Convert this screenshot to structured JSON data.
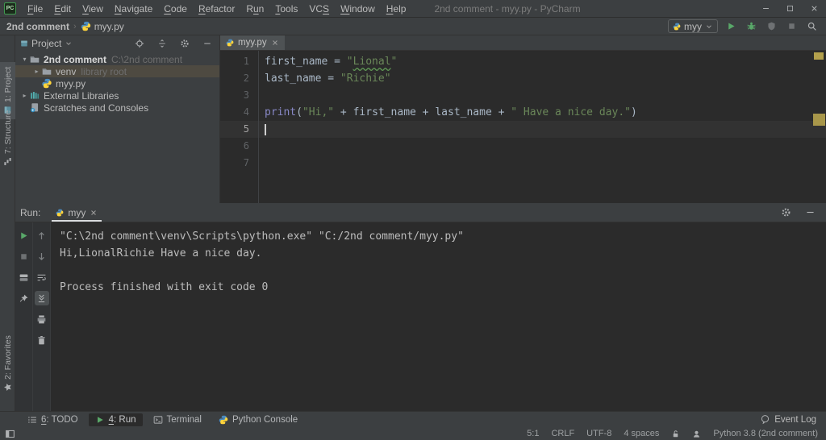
{
  "window": {
    "title": "2nd comment - myy.py - PyCharm",
    "logo_text": "PC"
  },
  "menu": {
    "items": [
      {
        "label": "File",
        "m": 0
      },
      {
        "label": "Edit",
        "m": 0
      },
      {
        "label": "View",
        "m": 0
      },
      {
        "label": "Navigate",
        "m": 0
      },
      {
        "label": "Code",
        "m": 0
      },
      {
        "label": "Refactor",
        "m": 0
      },
      {
        "label": "Run",
        "m": 1
      },
      {
        "label": "Tools",
        "m": 0
      },
      {
        "label": "VCS",
        "m": 2
      },
      {
        "label": "Window",
        "m": 0
      },
      {
        "label": "Help",
        "m": 0
      }
    ]
  },
  "breadcrumb": {
    "items": [
      "2nd comment",
      "myy.py"
    ]
  },
  "toolbar": {
    "run_config": "myy",
    "action_icons": [
      "run",
      "debug",
      "coverage",
      "stop",
      "search"
    ]
  },
  "stripe": {
    "items": [
      {
        "label": "1: Project",
        "icon": "toolwindow-project",
        "active": true
      },
      {
        "label": "7: Structure",
        "icon": "structure",
        "active": false
      },
      {
        "label": "2: Favorites",
        "icon": "star",
        "active": false
      }
    ]
  },
  "project": {
    "header": "Project",
    "header_icon": "toolwindow-project",
    "action_icons": [
      "locate",
      "collapse-all",
      "settings",
      "hide"
    ],
    "tree": [
      {
        "label": "2nd comment",
        "hint": "C:\\2nd comment",
        "icon": "folder",
        "arrow": "down",
        "bold": true,
        "indent": 0,
        "selected": false
      },
      {
        "label": "venv",
        "hint": "library root",
        "icon": "folder",
        "arrow": "right",
        "bold": false,
        "indent": 1,
        "selected": true
      },
      {
        "label": "myy.py",
        "hint": "",
        "icon": "python",
        "arrow": "",
        "bold": false,
        "indent": 1,
        "selected": false
      },
      {
        "label": "External Libraries",
        "hint": "",
        "icon": "libs",
        "arrow": "right",
        "bold": false,
        "indent": 0,
        "selected": false
      },
      {
        "label": "Scratches and Consoles",
        "hint": "",
        "icon": "scratch",
        "arrow": "",
        "bold": false,
        "indent": 0,
        "selected": false
      }
    ]
  },
  "editor": {
    "tab": "myy.py",
    "lines": [
      {
        "num": 1,
        "current": false,
        "tokens": [
          {
            "t": "first_name = ",
            "c": "plain"
          },
          {
            "t": "\"",
            "c": "str"
          },
          {
            "t": "Lional",
            "c": "str typo"
          },
          {
            "t": "\"",
            "c": "str"
          }
        ]
      },
      {
        "num": 2,
        "current": false,
        "tokens": [
          {
            "t": "last_name = ",
            "c": "plain"
          },
          {
            "t": "\"Richie\"",
            "c": "str"
          }
        ]
      },
      {
        "num": 3,
        "current": false,
        "tokens": []
      },
      {
        "num": 4,
        "current": false,
        "tokens": [
          {
            "t": "print",
            "c": "builtin"
          },
          {
            "t": "(",
            "c": "plain"
          },
          {
            "t": "\"Hi,\"",
            "c": "str"
          },
          {
            "t": " + first_name + last_name + ",
            "c": "plain"
          },
          {
            "t": "\" Have a nice day.\"",
            "c": "str"
          },
          {
            "t": ")",
            "c": "plain"
          }
        ]
      },
      {
        "num": 5,
        "current": true,
        "tokens": []
      },
      {
        "num": 6,
        "current": false,
        "tokens": []
      },
      {
        "num": 7,
        "current": false,
        "tokens": []
      }
    ]
  },
  "run": {
    "label": "Run:",
    "tab": "myy",
    "toolbar_outer": [
      "rerun",
      "stop",
      "restore-layout",
      "pin"
    ],
    "toolbar_inner": [
      "arrow-up",
      "arrow-down",
      "soft-wrap",
      "scroll-end",
      "print",
      "clear"
    ],
    "toolbar_selected": "scroll-end",
    "action_icons": [
      "settings",
      "hide"
    ],
    "console": [
      "\"C:\\2nd comment\\venv\\Scripts\\python.exe\" \"C:/2nd comment/myy.py\"",
      "Hi,LionalRichie Have a nice day.",
      "",
      "Process finished with exit code 0"
    ]
  },
  "bottom_tabs": [
    {
      "label": "6: TODO",
      "m": 0,
      "icon": "list",
      "active": false
    },
    {
      "label": "4: Run",
      "m": 0,
      "icon": "run",
      "active": true
    },
    {
      "label": "Terminal",
      "m": null,
      "icon": "terminal",
      "active": false
    },
    {
      "label": "Python Console",
      "m": null,
      "icon": "python",
      "active": false
    }
  ],
  "event_log": {
    "label": "Event Log",
    "icon": "event-log"
  },
  "status": {
    "items": [
      "5:1",
      "CRLF",
      "UTF-8",
      "4 spaces"
    ],
    "icons": [
      "lock",
      "hector"
    ],
    "interpreter": "Python 3.8 (2nd comment)"
  },
  "colors": {
    "panel_bg": "#3c3f41",
    "editor_bg": "#2b2b2b",
    "string_green": "#6a8759",
    "builtin_purple": "#8888c6",
    "run_green": "#59a869",
    "selection_brown": "#4e4a41",
    "scroll_mark_tan": "#b3a04c"
  }
}
